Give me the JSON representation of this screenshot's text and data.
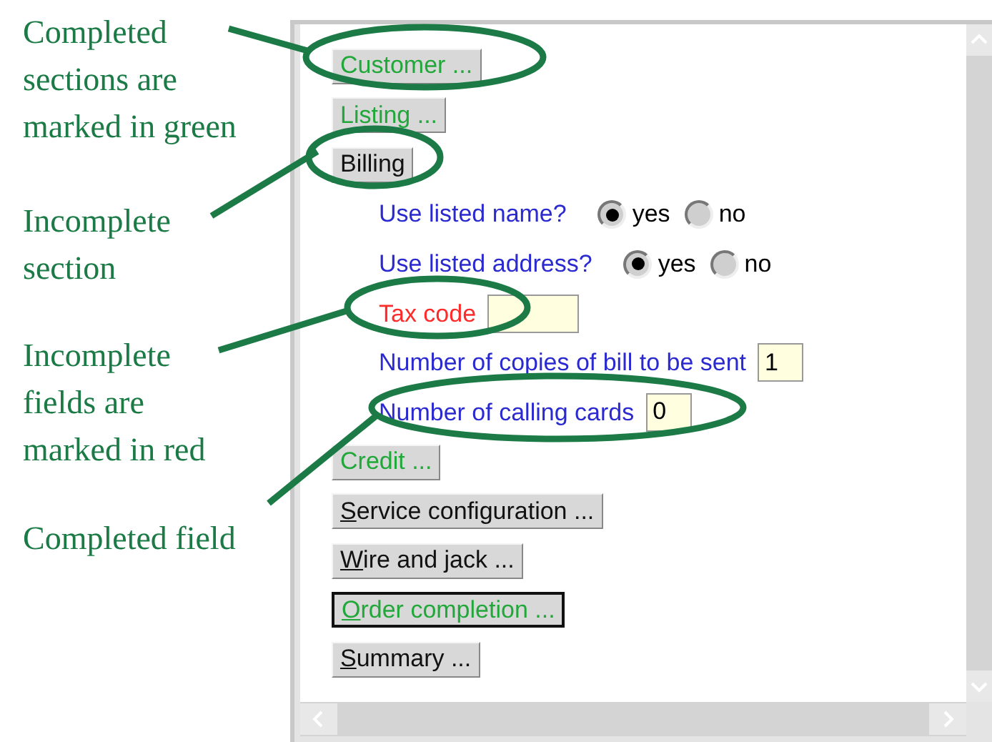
{
  "callouts": [
    {
      "lines": [
        "Completed",
        "sections are",
        "marked in green"
      ]
    },
    {
      "lines": [
        "Incomplete",
        "section"
      ]
    },
    {
      "lines": [
        "Incomplete",
        "fields are",
        "marked in red"
      ]
    },
    {
      "lines": [
        "Completed field"
      ]
    }
  ],
  "form": {
    "items": [
      {
        "kind": "section",
        "label": "Customer ...",
        "complete": true,
        "access_key_underlined": false,
        "focused": false
      },
      {
        "kind": "section",
        "label": "Listing ...",
        "complete": true,
        "access_key_underlined": false,
        "focused": false
      },
      {
        "kind": "section",
        "label": "Billing",
        "complete": false,
        "access_key_underlined": false,
        "focused": false
      },
      {
        "kind": "choice",
        "label": "Use listed name?",
        "complete": true,
        "options": [
          {
            "label": "yes",
            "selected": true
          },
          {
            "label": "no",
            "selected": false
          }
        ]
      },
      {
        "kind": "choice",
        "label": "Use listed address?",
        "complete": true,
        "options": [
          {
            "label": "yes",
            "selected": true
          },
          {
            "label": "no",
            "selected": false
          }
        ]
      },
      {
        "kind": "text",
        "label": "Tax code",
        "complete": false,
        "value": ""
      },
      {
        "kind": "text",
        "label": "Number of copies of bill to be sent",
        "complete": true,
        "value": "1"
      },
      {
        "kind": "text",
        "label": "Number of calling cards",
        "complete": true,
        "value": "0"
      },
      {
        "kind": "section",
        "label": "Credit ...",
        "complete": true,
        "access_key_underlined": false,
        "focused": false
      },
      {
        "kind": "section",
        "label": "Service configuration ...",
        "complete": false,
        "access_key_underlined": true,
        "focused": false
      },
      {
        "kind": "section",
        "label": "Wire and jack ...",
        "complete": false,
        "access_key_underlined": true,
        "focused": false
      },
      {
        "kind": "section",
        "label": "Order completion ...",
        "complete": true,
        "access_key_underlined": true,
        "focused": true
      },
      {
        "kind": "section",
        "label": "Summary ...",
        "complete": false,
        "access_key_underlined": true,
        "focused": false
      }
    ]
  }
}
